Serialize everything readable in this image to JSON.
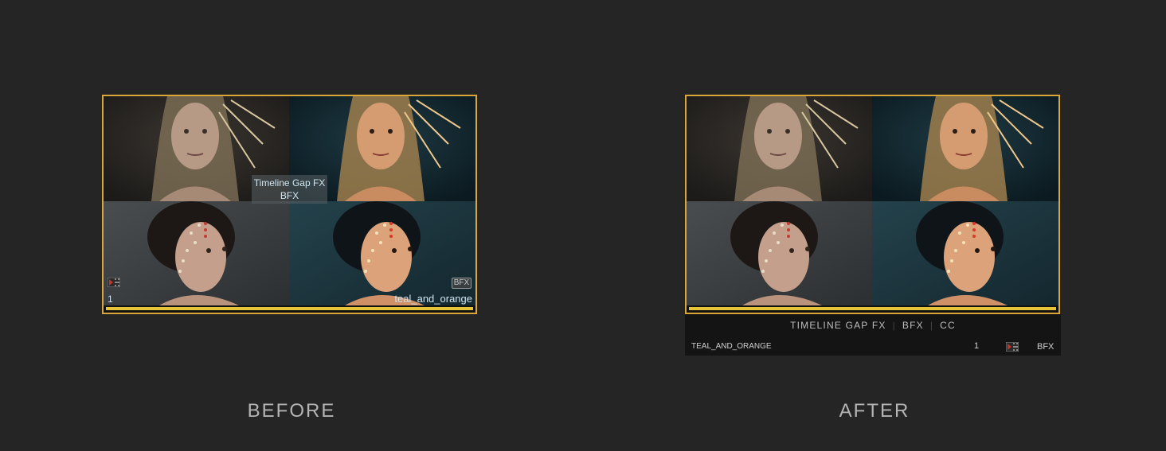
{
  "before": {
    "gap_label_line1": "Timeline Gap FX",
    "gap_label_line2": "BFX",
    "track_number": "1",
    "badge": "BFX",
    "effect_name": "teal_and_orange",
    "progress_fraction": 1.0
  },
  "after": {
    "info_items": [
      "TIMELINE GAP FX",
      "BFX",
      "CC"
    ],
    "effect_name": "TEAL_AND_ORANGE",
    "track_number": "1",
    "badge": "BFX",
    "progress_fraction": 1.0
  },
  "captions": {
    "before": "BEFORE",
    "after": "AFTER"
  },
  "icons": {
    "clip_type": "film-strip-icon"
  },
  "colors": {
    "background": "#252525",
    "selection_border": "#d9a637",
    "progress": "#e6c43a",
    "film_icon": "#c0342a",
    "overlay_text": "#cfe6f0"
  }
}
